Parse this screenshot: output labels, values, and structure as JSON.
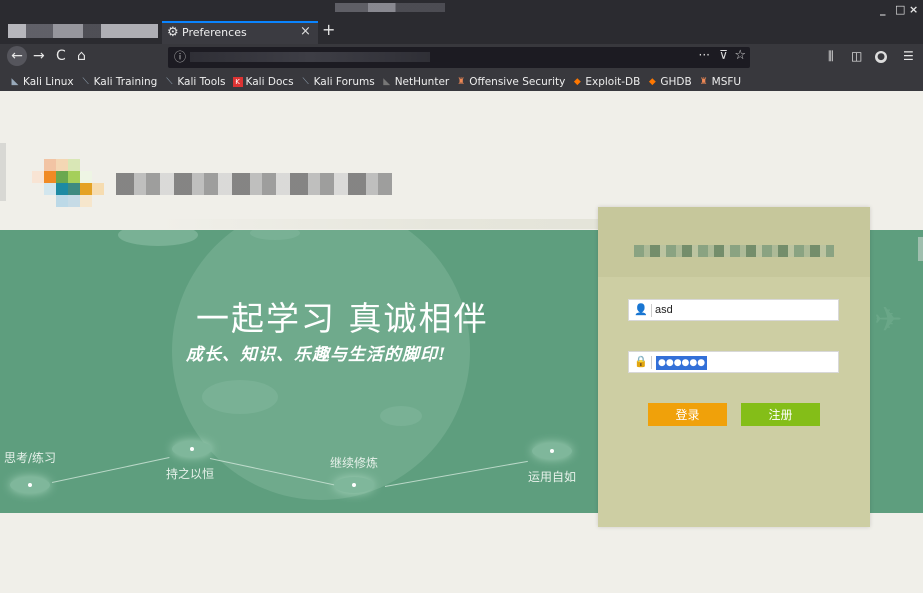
{
  "browser": {
    "active_tab": {
      "icon": "gear-icon",
      "title": "Preferences",
      "close": "×"
    },
    "new_tab": "+",
    "window_controls": [
      "_",
      "□",
      "×"
    ],
    "nav": {
      "back": "←",
      "forward": "→",
      "reload": "C",
      "home": "⌂"
    },
    "urlbar": {
      "info_icon": "ⓘ",
      "page_actions": "···",
      "pocket_icon": "pocket-icon",
      "star_icon": "star-icon"
    },
    "toolbar_right": [
      "library-icon",
      "sidebar-icon",
      "account-icon",
      "menu-icon"
    ],
    "bookmarks": [
      {
        "label": "Kali Linux",
        "icon": "kali-icon"
      },
      {
        "label": "Kali Training",
        "icon": "kali-icon"
      },
      {
        "label": "Kali Tools",
        "icon": "kali-icon"
      },
      {
        "label": "Kali Docs",
        "icon": "docs-icon"
      },
      {
        "label": "Kali Forums",
        "icon": "kali-icon"
      },
      {
        "label": "NetHunter",
        "icon": "nethunter-icon"
      },
      {
        "label": "Offensive Security",
        "icon": "offsec-icon"
      },
      {
        "label": "Exploit-DB",
        "icon": "exploitdb-icon"
      },
      {
        "label": "GHDB",
        "icon": "ghdb-icon"
      },
      {
        "label": "MSFU",
        "icon": "offsec-icon"
      }
    ]
  },
  "banner": {
    "title": "一起学习 真诚相伴",
    "subtitle": "成长、知识、乐趣与生活的脚印!",
    "steps": [
      "思考/练习",
      "持之以恒",
      "继续修炼",
      "运用自如"
    ]
  },
  "login": {
    "username": "asd",
    "password_mask": "●●●●●●",
    "login_button": "登录",
    "register_button": "注册"
  },
  "colors": {
    "banner_green": "#5e9e7e",
    "login_panel": "#cdcea3",
    "login_button": "#f0a10a",
    "register_button": "#84be18",
    "browser_dark": "#2b2b30"
  }
}
